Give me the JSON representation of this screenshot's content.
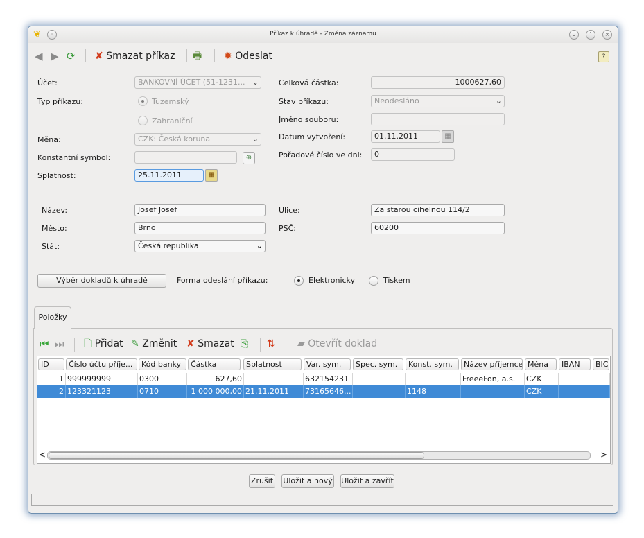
{
  "window": {
    "title": "Příkaz k úhradě - Změna záznamu"
  },
  "toolbar": {
    "delete_label": "Smazat příkaz",
    "send_label": "Odeslat"
  },
  "form": {
    "ucet_label": "Účet:",
    "ucet_value": "BANKOVNÍ ÚČET (51-1231...",
    "typ_label": "Typ příkazu:",
    "typ_options": [
      "Tuzemský",
      "Zahraniční"
    ],
    "mena_label": "Měna:",
    "mena_value": "CZK: Česká koruna",
    "ks_label": "Konstantní symbol:",
    "ks_value": "",
    "splatnost_label": "Splatnost:",
    "splatnost_value": "25.11.2011",
    "castka_label": "Celková částka:",
    "castka_value": "1000627,60",
    "stav_label": "Stav příkazu:",
    "stav_value": "Neodesláno",
    "soubor_label": "Jméno souboru:",
    "soubor_value": "",
    "datum_label": "Datum vytvoření:",
    "datum_value": "01.11.2011",
    "poradi_label": "Pořadové číslo ve dni:",
    "poradi_value": "0",
    "nazev_label": "Název:",
    "nazev_value": "Josef Josef",
    "mesto_label": "Město:",
    "mesto_value": "Brno",
    "stat_label": "Stát:",
    "stat_value": "Česká republika",
    "ulice_label": "Ulice:",
    "ulice_value": "Za starou cihelnou 114/2",
    "psc_label": "PSČ:",
    "psc_value": "60200",
    "vyber_button": "Výběr dokladů k úhradě",
    "forma_label": "Forma odeslání příkazu:",
    "forma_options": [
      "Elektronicky",
      "Tiskem"
    ],
    "forma_selected": "Elektronicky"
  },
  "items": {
    "tab_label": "Položky",
    "toolbar": {
      "add": "Přidat",
      "edit": "Změnit",
      "delete": "Smazat",
      "open_doc": "Otevřít doklad"
    },
    "columns": [
      "ID",
      "Číslo účtu příje...",
      "Kód banky",
      "Částka",
      "Splatnost",
      "Var. sym.",
      "Spec. sym.",
      "Konst. sym.",
      "Název příjemce",
      "Měna",
      "IBAN",
      "BIC"
    ],
    "rows": [
      [
        "1",
        "999999999",
        "0300",
        "627,60",
        "",
        "632154231",
        "",
        "",
        "FreeeFon, a.s.",
        "CZK",
        "",
        ""
      ],
      [
        "2",
        "123321123",
        "0710",
        "1 000 000,00",
        "21.11.2011",
        "73165646...",
        "",
        "1148",
        "",
        "CZK",
        "",
        ""
      ]
    ],
    "selected_row": 1
  },
  "footer": {
    "cancel": "Zrušit",
    "save_new": "Uložit a nový",
    "save_close": "Uložit a zavřít"
  },
  "colors": {
    "selection": "#3f8ad6",
    "window_border": "#6e8fb0"
  }
}
